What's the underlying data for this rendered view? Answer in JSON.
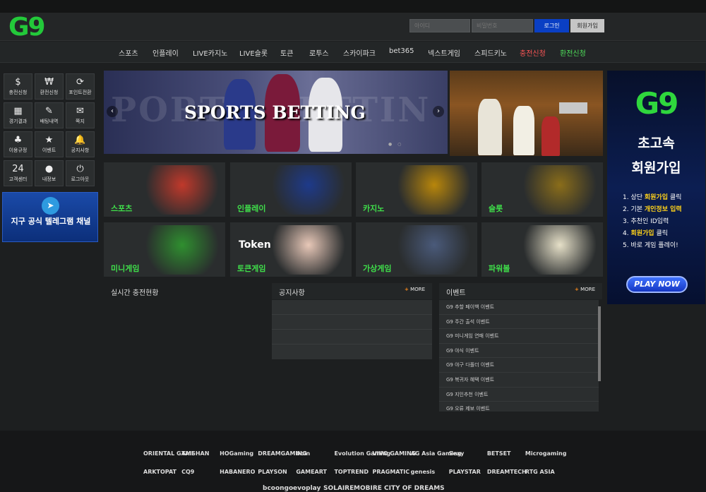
{
  "brand": {
    "logo": "G9"
  },
  "login": {
    "id_placeholder": "아이디",
    "pw_placeholder": "비밀번호",
    "login_label": "로그인",
    "join_label": "회원가입"
  },
  "nav": [
    {
      "label": "스포츠",
      "style": "normal"
    },
    {
      "label": "인플레이",
      "style": "normal"
    },
    {
      "label": "LIVE카지노",
      "style": "normal"
    },
    {
      "label": "LIVE슬롯",
      "style": "normal"
    },
    {
      "label": "토큰",
      "style": "normal"
    },
    {
      "label": "로투스",
      "style": "normal"
    },
    {
      "label": "스카이파크",
      "style": "normal"
    },
    {
      "label": "bet365",
      "style": "normal"
    },
    {
      "label": "넥스트게임",
      "style": "normal"
    },
    {
      "label": "스피드키노",
      "style": "normal"
    },
    {
      "label": "충전신청",
      "style": "red"
    },
    {
      "label": "환전신청",
      "style": "green"
    }
  ],
  "sidebar": {
    "buttons": [
      {
        "label": "충전신청",
        "icon": "deposit-icon",
        "glyph": "$"
      },
      {
        "label": "환전신청",
        "icon": "withdraw-icon",
        "glyph": "₩"
      },
      {
        "label": "포인트전환",
        "icon": "point-exchange-icon",
        "glyph": "⟳"
      },
      {
        "label": "경기결과",
        "icon": "scoreboard-icon",
        "glyph": "▦"
      },
      {
        "label": "배팅내역",
        "icon": "bet-history-icon",
        "glyph": "✎"
      },
      {
        "label": "쪽지",
        "icon": "mail-icon",
        "glyph": "✉"
      },
      {
        "label": "이용규정",
        "icon": "clover-icon",
        "glyph": "♣"
      },
      {
        "label": "이벤트",
        "icon": "star-icon",
        "glyph": "★"
      },
      {
        "label": "공지사항",
        "icon": "bell-icon",
        "glyph": "🔔"
      },
      {
        "label": "고객센터",
        "icon": "support-24-icon",
        "glyph": "24"
      },
      {
        "label": "내정보",
        "icon": "user-icon",
        "glyph": "●"
      },
      {
        "label": "로그아웃",
        "icon": "power-icon",
        "glyph": "⏻"
      }
    ],
    "telegram_label": "지구 공식 텔레그램 채널"
  },
  "banner": {
    "title": "SPORTS BETTING",
    "ghost_text": "PORTS BETTIN"
  },
  "tiles": [
    {
      "label": "스포츠",
      "accent": "#c0392b"
    },
    {
      "label": "인플레이",
      "accent": "#1e3a8a"
    },
    {
      "label": "카지노",
      "accent": "#b8860b"
    },
    {
      "label": "슬롯",
      "accent": "#8a6d1a"
    },
    {
      "label": "미니게임",
      "accent": "#2f8f2f"
    },
    {
      "label": "토큰게임",
      "accent": "#e8c8b8"
    },
    {
      "label": "가상게임",
      "accent": "#4a5a7a"
    },
    {
      "label": "파워볼",
      "accent": "#e6e0c8"
    }
  ],
  "token_logo": "Token",
  "ad": {
    "logo": "G9",
    "title1": "초고속",
    "title2": "회원가입",
    "steps": [
      {
        "pre": "1. 상단 ",
        "hl": "회원가입",
        "post": " 클릭"
      },
      {
        "pre": "2. 기본 ",
        "hl": "개인정보 입력",
        "post": ""
      },
      {
        "pre": "3. 추천인 ID입력",
        "hl": "",
        "post": ""
      },
      {
        "pre": "4. ",
        "hl": "회원가입",
        "post": " 클릭"
      },
      {
        "pre": "5. 바로 게임 플레이!",
        "hl": "",
        "post": ""
      }
    ],
    "play_label": "PLAY NOW"
  },
  "panels": {
    "live": {
      "title": "실시간 충전현황"
    },
    "notice": {
      "title": "공지사항",
      "more": "MORE"
    },
    "events": {
      "title": "이벤트",
      "more": "MORE",
      "items": [
        "G9 추할 페이백 이벤트",
        "G9 주간 출석 이벤트",
        "G9 미니게임 연패 이벤트",
        "G9 야식 이벤트",
        "G9 야구 다폴더 이벤트",
        "G9 복귀자 혜택 이벤트",
        "G9 지인추천 이벤트",
        "G9 오류 제보 이벤트"
      ]
    }
  },
  "providers": {
    "row1": [
      "ORIENTAL GAME",
      "TAISHAN",
      "HOGaming",
      "DREAMGAMING",
      "bbin",
      "Evolution Gaming",
      "VIVO GAMING",
      "AG Asia Gaming",
      "Sexy",
      "BETSET",
      "Microgaming"
    ],
    "row2": [
      "ARKTOPAT",
      "CQ9",
      "HABANERO",
      "PLAYSON",
      "GAMEART",
      "TOPTREND",
      "PRAGMATIC",
      "genesis",
      "PLAYSTAR",
      "DREAMTECH",
      "RTG ASIA"
    ],
    "row3": [
      "bcoongo",
      "evoplay",
      "SOLAIRE",
      "MOBIRE",
      "CITY OF DREAMS"
    ]
  },
  "colors": {
    "accent_green": "#23c93a",
    "nav_red": "#ff5656",
    "nav_green": "#4fe05a",
    "login_blue": "#0a3fc4"
  }
}
